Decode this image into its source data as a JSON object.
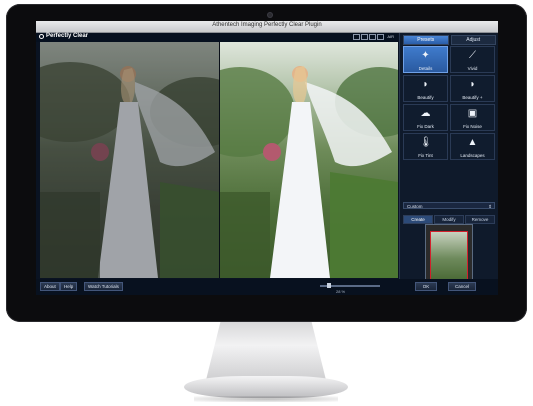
{
  "window": {
    "title": "Athentech Imaging Perfectly Clear Plugin"
  },
  "app": {
    "logo": "Perfectly Clear",
    "view_mode_label": "⊞ 2 ▥ ▦ ALL"
  },
  "view_buttons": [
    "single",
    "split-vertical",
    "split-horizontal",
    "before-after"
  ],
  "panel": {
    "tabs": [
      {
        "label": "Presets",
        "active": true
      },
      {
        "label": "Adjust",
        "active": false
      }
    ],
    "presets": [
      {
        "label": "Details",
        "icon": "sparkle-icon",
        "selected": true
      },
      {
        "label": "Vivid",
        "icon": "wand-icon",
        "selected": false
      },
      {
        "label": "Beautify",
        "icon": "face-icon",
        "selected": false
      },
      {
        "label": "Beautify +",
        "icon": "face-plus-icon",
        "selected": false
      },
      {
        "label": "Fix Dark",
        "icon": "cloud-icon",
        "selected": false
      },
      {
        "label": "Fix Noise",
        "icon": "noise-icon",
        "selected": false
      },
      {
        "label": "Fix Tint",
        "icon": "thermometer-icon",
        "selected": false
      },
      {
        "label": "Landscapes",
        "icon": "landscape-icon",
        "selected": false
      }
    ],
    "custom_select": "Custom",
    "preset_actions": [
      {
        "label": "Create",
        "active": true
      },
      {
        "label": "Modify",
        "active": false
      },
      {
        "label": "Remove",
        "active": false
      }
    ]
  },
  "bottombar": {
    "buttons": [
      "About",
      "Help",
      "Watch Tutorials"
    ],
    "zoom_label": "28 %",
    "ok": "OK",
    "cancel": "Cancel"
  },
  "colors": {
    "accent": "#3f7bcc",
    "preview_frame": "#d3202c",
    "panel_bg": "#0f1a2b"
  }
}
